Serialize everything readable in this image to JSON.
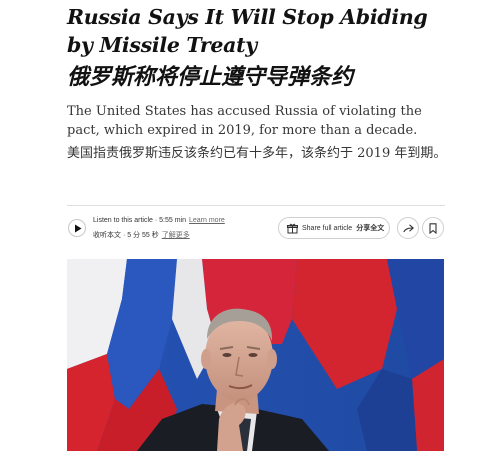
{
  "headline": {
    "english": "Russia Says It Will Stop Abiding by Missile Treaty",
    "chinese": "俄罗斯称将停止遵守导弹条约"
  },
  "summary": {
    "english": "The United States has accused Russia of violating the pact, which expired in 2019, for more than a decade.",
    "chinese": "美国指责俄罗斯违反该条约已有十多年，该条约于 2019 年到期。"
  },
  "audio": {
    "english_line": "Listen to this article · 5:55 min",
    "learn_more": "Learn more",
    "chinese_line": "收听本文 · 5 分 55 秒",
    "chinese_learn_more": "了解更多"
  },
  "share": {
    "english_label": "Share full article",
    "chinese_label": "分享全文"
  },
  "icons": {
    "play": "play-icon",
    "gift": "gift-icon",
    "forward": "forward-arrow-icon",
    "bookmark": "bookmark-icon"
  },
  "colors": {
    "flag_white": "#f2f2f4",
    "flag_blue": "#1b48a8",
    "flag_red": "#d3232b"
  }
}
